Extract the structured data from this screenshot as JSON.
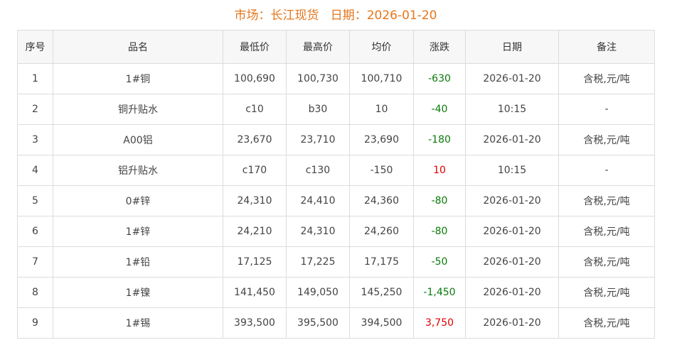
{
  "header": {
    "market_label": "市场：长江现货",
    "date_label": "日期：2026-01-20"
  },
  "table": {
    "columns": [
      "序号",
      "品名",
      "最低价",
      "最高价",
      "均价",
      "涨跌",
      "日期",
      "备注"
    ],
    "rows": [
      {
        "no": "1",
        "name": "1#铜",
        "low": "100,690",
        "high": "100,730",
        "avg": "100,710",
        "change": "-630",
        "trend": "down",
        "date": "2026-01-20",
        "note": "含税,元/吨"
      },
      {
        "no": "2",
        "name": "铜升贴水",
        "low": "c10",
        "high": "b30",
        "avg": "10",
        "change": "-40",
        "trend": "down",
        "date": "10:15",
        "note": "-"
      },
      {
        "no": "3",
        "name": "A00铝",
        "low": "23,670",
        "high": "23,710",
        "avg": "23,690",
        "change": "-180",
        "trend": "down",
        "date": "2026-01-20",
        "note": "含税,元/吨"
      },
      {
        "no": "4",
        "name": "铝升贴水",
        "low": "c170",
        "high": "c130",
        "avg": "-150",
        "change": "10",
        "trend": "up",
        "date": "10:15",
        "note": "-"
      },
      {
        "no": "5",
        "name": "0#锌",
        "low": "24,310",
        "high": "24,410",
        "avg": "24,360",
        "change": "-80",
        "trend": "down",
        "date": "2026-01-20",
        "note": "含税,元/吨"
      },
      {
        "no": "6",
        "name": "1#锌",
        "low": "24,210",
        "high": "24,310",
        "avg": "24,260",
        "change": "-80",
        "trend": "down",
        "date": "2026-01-20",
        "note": "含税,元/吨"
      },
      {
        "no": "7",
        "name": "1#铅",
        "low": "17,125",
        "high": "17,225",
        "avg": "17,175",
        "change": "-50",
        "trend": "down",
        "date": "2026-01-20",
        "note": "含税,元/吨"
      },
      {
        "no": "8",
        "name": "1#镍",
        "low": "141,450",
        "high": "149,050",
        "avg": "145,250",
        "change": "-1,450",
        "trend": "down",
        "date": "2026-01-20",
        "note": "含税,元/吨"
      },
      {
        "no": "9",
        "name": "1#锡",
        "low": "393,500",
        "high": "395,500",
        "avg": "394,500",
        "change": "3,750",
        "trend": "up",
        "date": "2026-01-20",
        "note": "含税,元/吨"
      }
    ]
  },
  "colors": {
    "title": "#e6761b",
    "up": "#e00000",
    "down": "#0a7a0a",
    "header_bg": "#f7f7f7",
    "border": "#dcdcdc"
  }
}
